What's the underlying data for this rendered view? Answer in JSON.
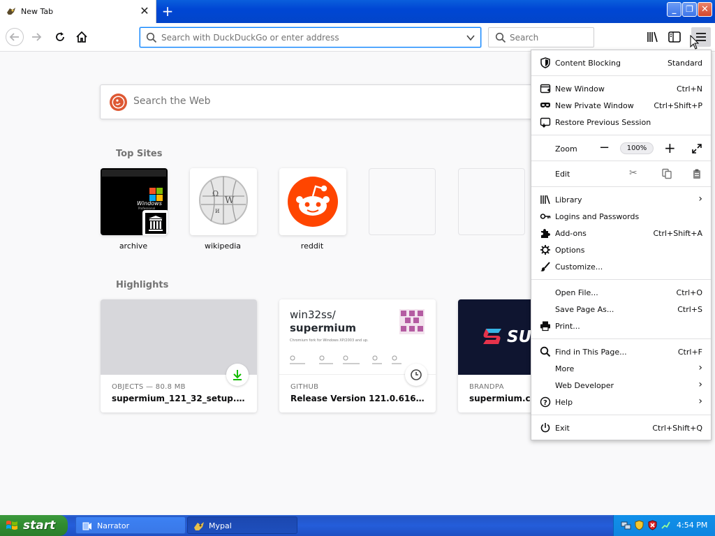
{
  "browser": {
    "tab": {
      "title": "New Tab"
    },
    "urlbar": {
      "placeholder": "Search with DuckDuckGo or enter address"
    },
    "searchbar": {
      "placeholder": "Search"
    }
  },
  "newtab": {
    "web_search_placeholder": "Search the Web",
    "top_sites_heading": "Top Sites",
    "top_sites": [
      {
        "label": "archive"
      },
      {
        "label": "wikipedia"
      },
      {
        "label": "reddit"
      }
    ],
    "highlights_heading": "Highlights",
    "highlights": [
      {
        "source": "OBJECTS — 80.8 MB",
        "title": "supermium_121_32_setup.exe"
      },
      {
        "source": "GITHUB",
        "title": "Release Version 121.0.6167.81 ...",
        "preview_title_1": "win32ss/",
        "preview_title_2": "supermium",
        "preview_desc": "Chromium fork for Windows XP/2003 and up."
      },
      {
        "source": "BRANDPA",
        "title": "supermium.com",
        "preview_logo_text": "SUP"
      }
    ]
  },
  "app_menu": {
    "content_blocking": {
      "label": "Content Blocking",
      "value": "Standard"
    },
    "new_window": {
      "label": "New Window",
      "shortcut": "Ctrl+N"
    },
    "new_private_window": {
      "label": "New Private Window",
      "shortcut": "Ctrl+Shift+P"
    },
    "restore_session": {
      "label": "Restore Previous Session"
    },
    "zoom": {
      "label": "Zoom",
      "value": "100%"
    },
    "edit": {
      "label": "Edit"
    },
    "library": {
      "label": "Library"
    },
    "logins": {
      "label": "Logins and Passwords"
    },
    "addons": {
      "label": "Add-ons",
      "shortcut": "Ctrl+Shift+A"
    },
    "options": {
      "label": "Options"
    },
    "customize": {
      "label": "Customize..."
    },
    "open_file": {
      "label": "Open File...",
      "shortcut": "Ctrl+O"
    },
    "save_page": {
      "label": "Save Page As...",
      "shortcut": "Ctrl+S"
    },
    "print": {
      "label": "Print..."
    },
    "find": {
      "label": "Find in This Page...",
      "shortcut": "Ctrl+F"
    },
    "more": {
      "label": "More"
    },
    "web_developer": {
      "label": "Web Developer"
    },
    "help": {
      "label": "Help"
    },
    "exit": {
      "label": "Exit",
      "shortcut": "Ctrl+Shift+Q"
    }
  },
  "taskbar": {
    "start_label": "start",
    "items": [
      {
        "label": "Narrator"
      },
      {
        "label": "Mypal"
      }
    ],
    "clock": "4:54 PM"
  },
  "colors": {
    "accent": "#0a84ff",
    "reddit": "#ff4500",
    "duckduckgo": "#de5833",
    "xp_taskbar": "#245dda",
    "xp_start": "#2f8b2f"
  }
}
